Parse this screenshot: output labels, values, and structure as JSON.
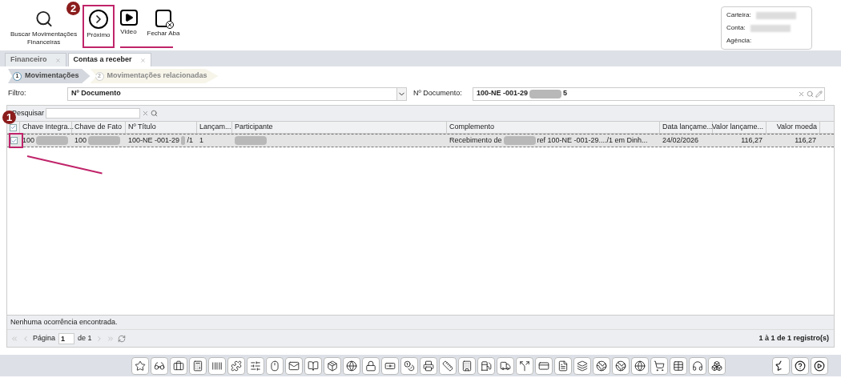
{
  "toolbar": {
    "buttons": [
      {
        "kind": "search",
        "label": [
          "Buscar Movimentações",
          "Financeiras"
        ],
        "highlighted": false
      },
      {
        "kind": "next",
        "label": [
          "Próximo"
        ],
        "highlighted": true,
        "badge": "2"
      },
      {
        "kind": "video",
        "label": [
          "Video"
        ],
        "highlighted": false
      },
      {
        "kind": "close-tab",
        "label": [
          "Fechar Aba"
        ],
        "highlighted": false
      }
    ]
  },
  "info_box": [
    {
      "label": "Carteira:",
      "blurred": true
    },
    {
      "label": "Conta:",
      "blurred": true
    },
    {
      "label": "Agência:",
      "blurred": false
    }
  ],
  "tabs": [
    {
      "label": "Financeiro",
      "selected": false
    },
    {
      "label": "Contas a receber",
      "selected": true
    }
  ],
  "steps": [
    {
      "number": "1",
      "label": "Movimentações",
      "selected": true
    },
    {
      "number": "2",
      "label": "Movimentações relacionadas",
      "selected": false
    }
  ],
  "filter": {
    "label": "Filtro:",
    "value": "Nº Documento",
    "doc_label": "Nº Documento:",
    "doc_value": [
      {
        "kind": "text",
        "text": "100-NE -001-29"
      },
      {
        "kind": "blur"
      },
      {
        "kind": "text",
        "text": "5"
      }
    ]
  },
  "grid": {
    "search_label": "Pesquisar",
    "badge": "1",
    "header_checked": true,
    "columns": [
      "Chave Integra...",
      "Chave de Fato",
      "Nº Título",
      "Lançam...",
      "Participante",
      "Complemento",
      "Data lançame...",
      "Valor lançame...",
      "Valor moeda"
    ],
    "rows": [
      {
        "checked": true,
        "selected": true,
        "cells": [
          [
            {
              "kind": "text",
              "text": "100"
            },
            {
              "kind": "blur"
            }
          ],
          [
            {
              "kind": "text",
              "text": "100"
            },
            {
              "kind": "blur"
            }
          ],
          [
            {
              "kind": "text",
              "text": "100-NE -001-29"
            },
            {
              "kind": "blur"
            },
            {
              "kind": "text",
              "text": "/1"
            }
          ],
          [
            {
              "kind": "text",
              "text": "1"
            }
          ],
          [
            {
              "kind": "blur"
            }
          ],
          [
            {
              "kind": "text",
              "text": "Recebimento de"
            },
            {
              "kind": "blur"
            },
            {
              "kind": "text",
              "text": "ref 100-NE -001-29..../1 em Dinh..."
            }
          ],
          [
            {
              "kind": "text",
              "text": "24/02/2026"
            }
          ],
          [
            {
              "kind": "text",
              "text": "116,27"
            }
          ],
          [
            {
              "kind": "text",
              "text": "116,27"
            }
          ]
        ]
      }
    ],
    "status": "Nenhuma ocorrência encontrada.",
    "pager": {
      "page_label": "Página",
      "page": "1",
      "of": "de 1",
      "summary": "1 à 1 de 1 registro(s)"
    }
  }
}
